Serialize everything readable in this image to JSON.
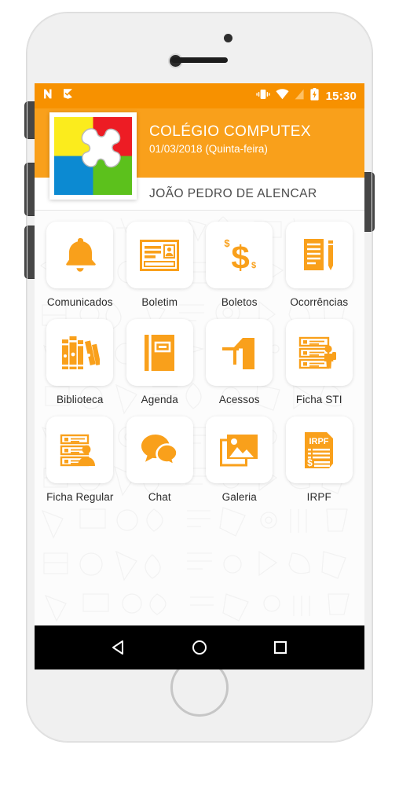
{
  "device": {
    "name": "white-smartphone-mockup",
    "buttons": [
      "silent-switch",
      "volume-up",
      "volume-down",
      "power"
    ],
    "home_button": "home-button"
  },
  "status_bar": {
    "background": "#f79100",
    "notifications": [
      "android-n-icon",
      "flag-check-icon"
    ],
    "icons": [
      "vibrate-icon",
      "wifi-icon",
      "signal-off-icon",
      "battery-charging-icon"
    ],
    "time": "15:30"
  },
  "header": {
    "background": "#f9a01b",
    "logo": "puzzle-logo",
    "logo_colors": {
      "top_left": "#fbec1d",
      "top_right": "#ed1c24",
      "bottom_left": "#0c8ad2",
      "bottom_right": "#5cc11c"
    },
    "school_name": "COLÉGIO COMPUTEX",
    "date": "01/03/2018 (Quinta-feira)",
    "student_name": "JOÃO PEDRO DE ALENCAR"
  },
  "accent_color": "#f9a01b",
  "grid": {
    "tiles": [
      {
        "label": "Comunicados",
        "icon": "bell-icon"
      },
      {
        "label": "Boletim",
        "icon": "id-card-icon"
      },
      {
        "label": "Boletos",
        "icon": "dollar-sign-icon"
      },
      {
        "label": "Ocorrências",
        "icon": "document-pencil-icon"
      },
      {
        "label": "Biblioteca",
        "icon": "books-icon"
      },
      {
        "label": "Agenda",
        "icon": "notebook-icon"
      },
      {
        "label": "Acessos",
        "icon": "turnstile-icon"
      },
      {
        "label": "Ficha STI",
        "icon": "checklist-student-icon"
      },
      {
        "label": "Ficha Regular",
        "icon": "checklist-person-icon"
      },
      {
        "label": "Chat",
        "icon": "chat-bubbles-icon"
      },
      {
        "label": "Galeria",
        "icon": "photos-icon"
      },
      {
        "label": "IRPF",
        "icon": "irpf-document-icon"
      }
    ]
  },
  "nav_bar": {
    "background": "#000000",
    "buttons": [
      {
        "name": "back-button",
        "icon": "triangle-back-icon"
      },
      {
        "name": "home-button",
        "icon": "circle-home-icon"
      },
      {
        "name": "recents-button",
        "icon": "square-recents-icon"
      }
    ]
  }
}
